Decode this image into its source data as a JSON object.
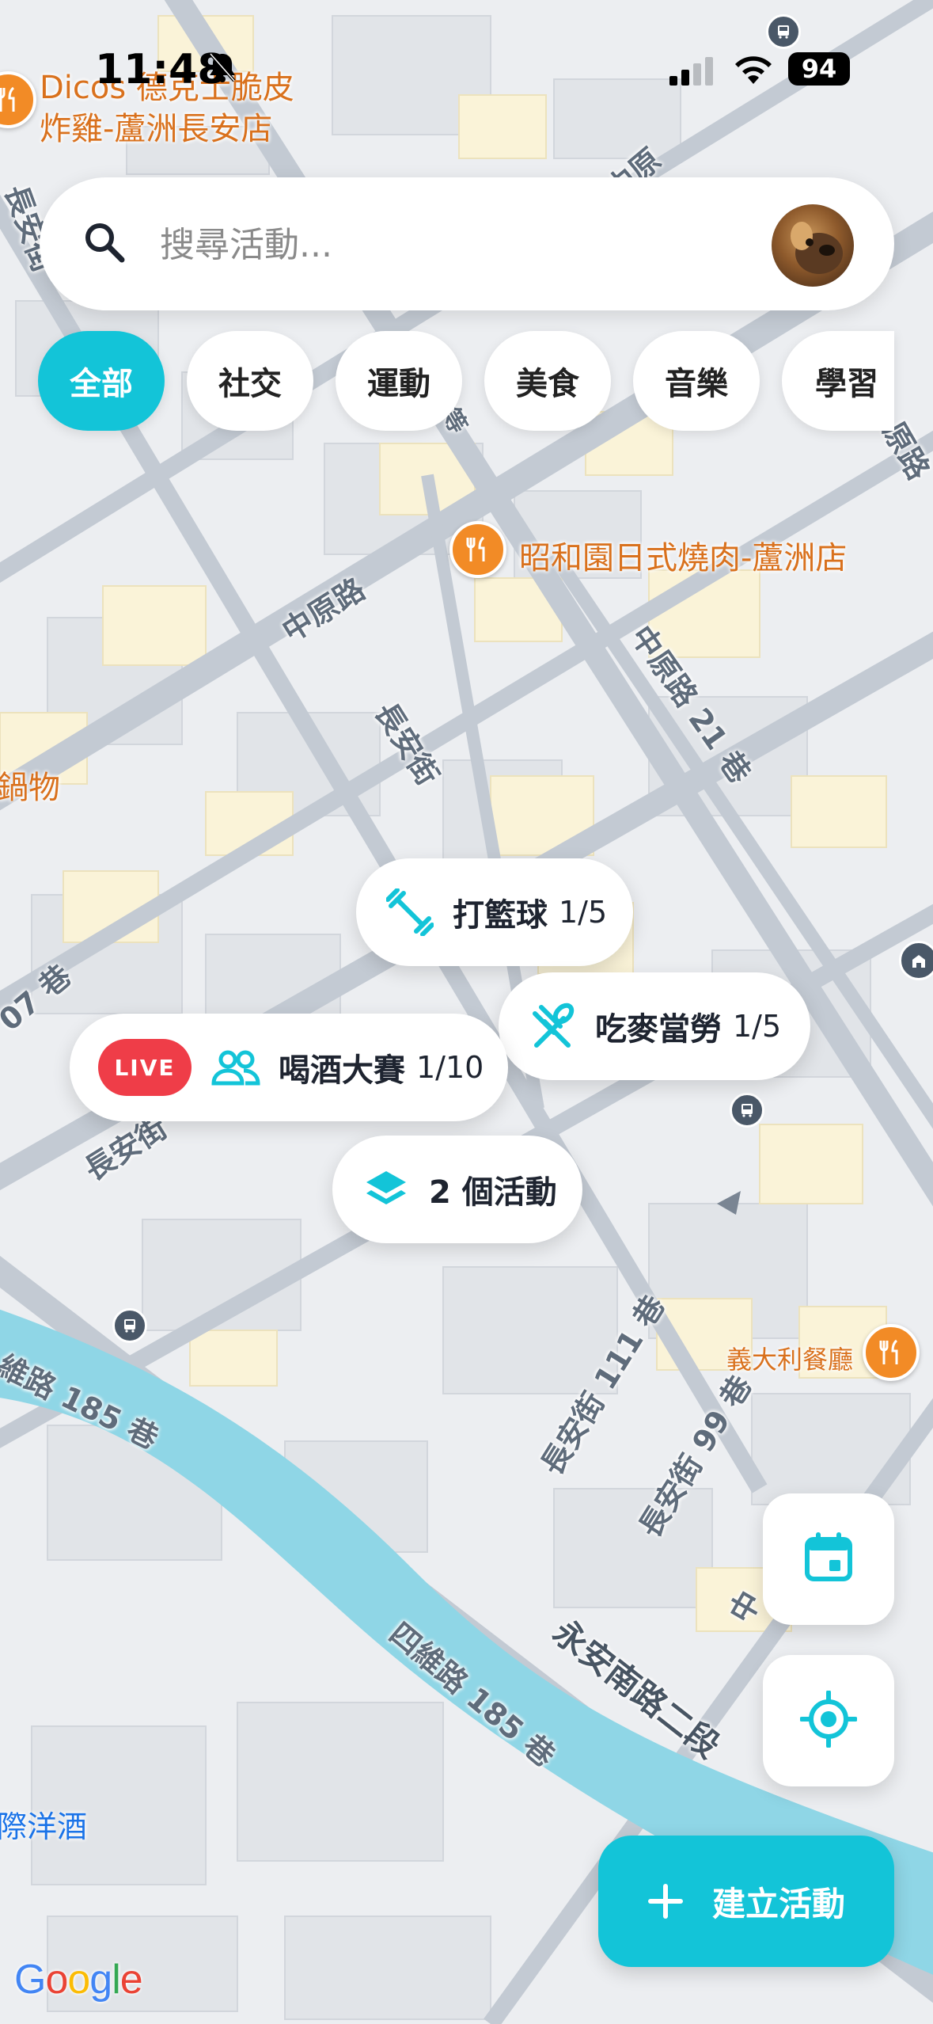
{
  "status_bar": {
    "time": "11:48",
    "battery": "94"
  },
  "search": {
    "placeholder": "搜尋活動..."
  },
  "chips": [
    "全部",
    "社交",
    "運動",
    "美食",
    "音樂",
    "學習"
  ],
  "map_labels": {
    "poi_dicos_line1": "Dicos 德克士脆皮",
    "poi_dicos_line2": "炸雞-蘆洲長安店",
    "poi_bbq": "昭和園日式燒肉-蘆洲店",
    "poi_italian": "義大利餐廳",
    "poi_left_fragment": "鍋物",
    "poi_bottom_fragment": "際洋酒",
    "road_zhongyuan": "中原路",
    "road_zhongyuan_21": "中原路 21 巷",
    "road_changan": "長安街",
    "road_changan_left": "長安街",
    "road_changan_111": "長安街 111 巷",
    "road_changan_99": "長安街 99 巷",
    "road_siwei_185": "四維路 185 巷",
    "road_siwei_185_left": "維路 185 巷",
    "road_yongan": "永安南路二段",
    "road_207": "07 巷",
    "road_top_zhong": "中原",
    "road_right_yuan": "原路",
    "road_right_zhong": "中",
    "road_left_changan": "長安街",
    "road_small_deng": "等"
  },
  "activities": [
    {
      "title": "打籃球",
      "count": "1/5",
      "icon": "dumbbell-icon"
    },
    {
      "title": "吃麥當勞",
      "count": "1/5",
      "icon": "utensils-icon"
    },
    {
      "badge": "LIVE",
      "title": "喝酒大賽",
      "count": "1/10",
      "icon": "people-icon"
    },
    {
      "title": "2 個活動",
      "icon": "layers-icon"
    }
  ],
  "create_button": {
    "label": "建立活動"
  },
  "attribution": "Google",
  "colors": {
    "accent": "#13c4d8",
    "live": "#ef3d48",
    "poi": "#d9711d",
    "river": "#8fd6e6"
  }
}
